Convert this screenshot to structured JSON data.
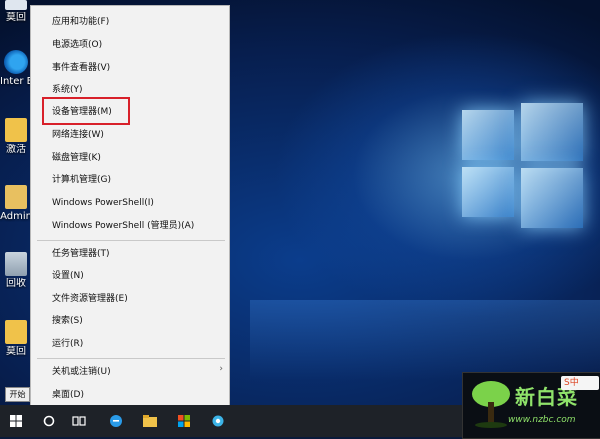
{
  "menu": {
    "items": [
      "应用和功能(F)",
      "电源选项(O)",
      "事件查看器(V)",
      "系统(Y)",
      "设备管理器(M)",
      "网络连接(W)",
      "磁盘管理(K)",
      "计算机管理(G)",
      "Windows PowerShell(I)",
      "Windows PowerShell (管理员)(A)",
      "任务管理器(T)",
      "设置(N)",
      "文件资源管理器(E)",
      "搜索(S)",
      "运行(R)",
      "关机或注销(U)",
      "桌面(D)"
    ],
    "submenu_arrow": "›"
  },
  "desktop": {
    "icons": [
      "莫回",
      "Inter Explo",
      "激活",
      "Admin",
      "回收",
      "莫回"
    ]
  },
  "taskbar": {
    "start_tooltip": "开始"
  },
  "watermark": {
    "title": "新白菜",
    "url": "www.nzbc.com",
    "badge": "S中"
  },
  "colors": {
    "highlight_border": "#d8202a",
    "menu_bg": "#f2f2f2",
    "taskbar_bg": "#1e2228"
  }
}
